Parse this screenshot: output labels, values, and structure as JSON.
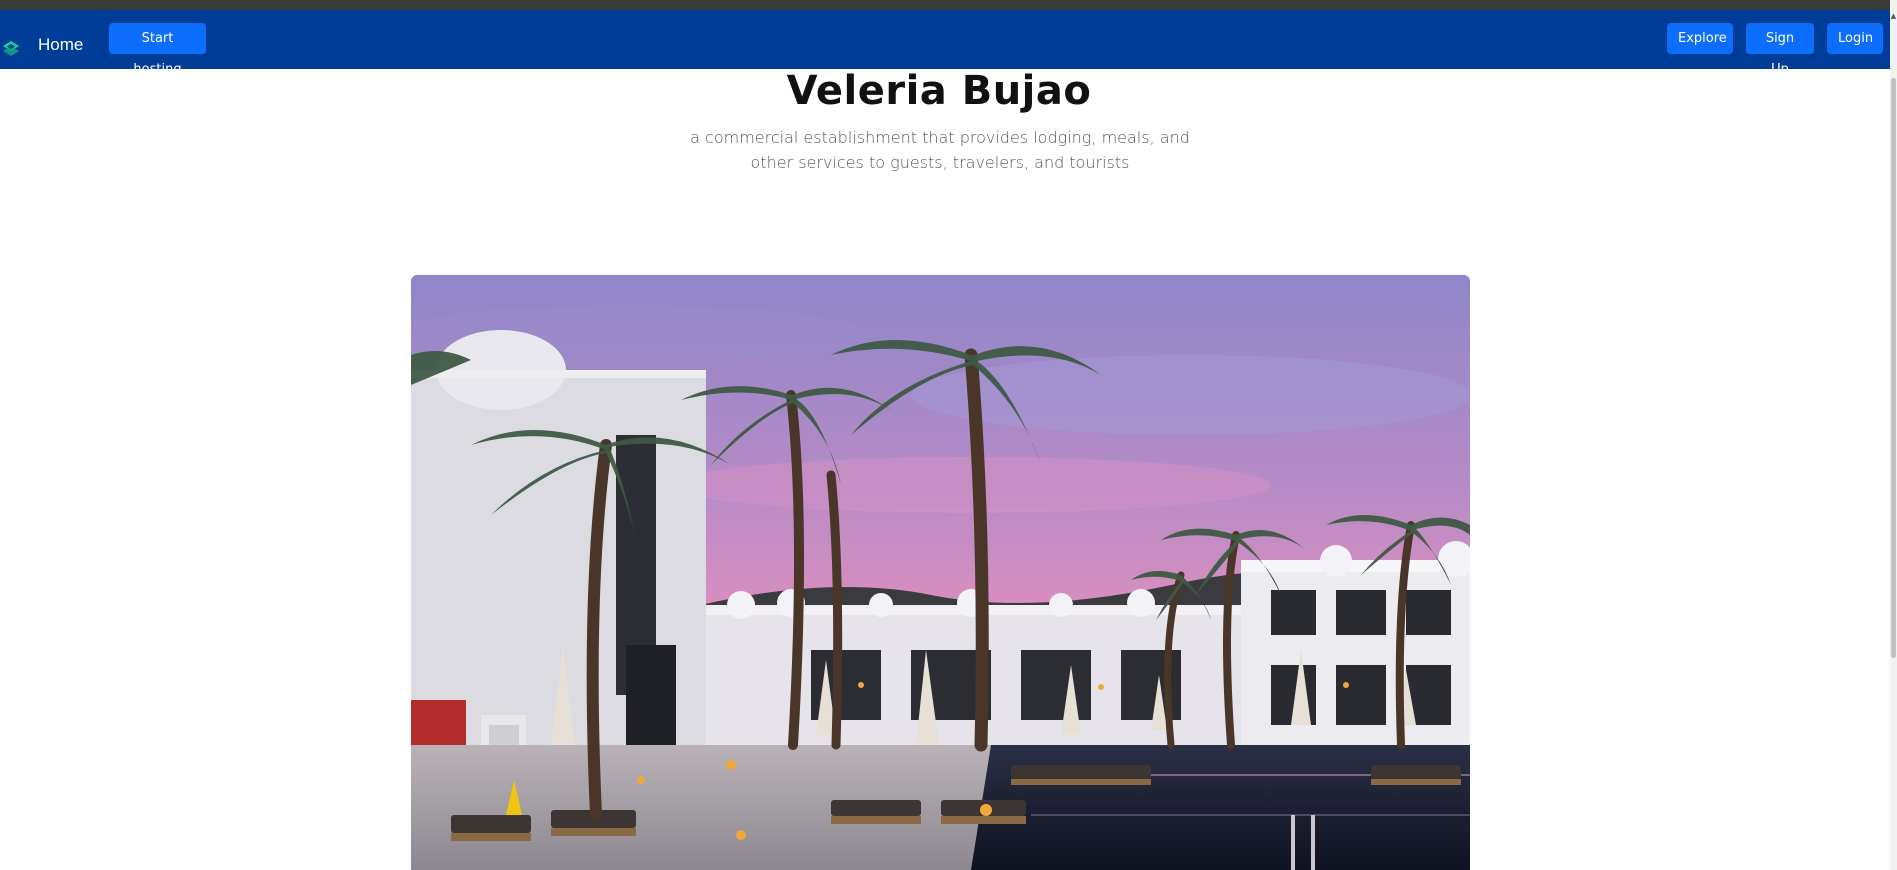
{
  "navbar": {
    "logo_icon": "stacked-layers-icon",
    "home_label": "Home",
    "start_hosting_label": "Start hosting",
    "explore_label": "Explore",
    "signup_label": "Sign Up",
    "login_label": "Login",
    "background_color": "#003d99",
    "button_color": "#0d6efd",
    "logo_color": "#20c997"
  },
  "hero": {
    "title": "Veleria Bujao",
    "subtitle": "a commercial establishment that provides lodging, meals, and other services to guests, travelers, and tourists",
    "image_icon": "hotel-photo"
  }
}
